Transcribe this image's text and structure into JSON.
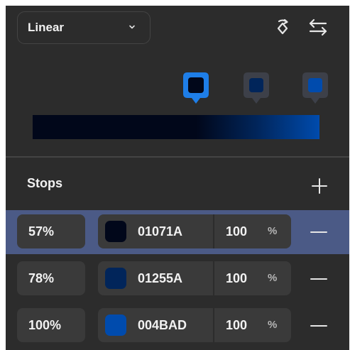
{
  "header": {
    "gradient_type": "Linear",
    "icons": {
      "dropdown": "chevron-down-icon",
      "rotate": "rotate-icon",
      "swap": "swap-arrows-icon"
    }
  },
  "gradient": {
    "colors": [
      "#01071A",
      "#01255A",
      "#004BAD"
    ],
    "positions_percent": [
      57,
      78,
      100
    ],
    "selected_index": 0,
    "selected_outline_color": "#1e7ee8",
    "unselected_marker_color": "#3d4049"
  },
  "stops_section": {
    "heading": "Stops",
    "add_icon": "plus-icon",
    "remove_icon": "minus-icon",
    "percent_symbol": "%",
    "rows": [
      {
        "position": "57%",
        "hex": "01071A",
        "color": "#01071A",
        "opacity": "100",
        "selected": true
      },
      {
        "position": "78%",
        "hex": "01255A",
        "color": "#01255A",
        "opacity": "100",
        "selected": false
      },
      {
        "position": "100%",
        "hex": "004BAD",
        "color": "#004BAD",
        "opacity": "100",
        "selected": false
      }
    ]
  },
  "theme": {
    "panel_bg": "#2c2c2c",
    "field_bg": "#3a3a3a",
    "selected_row_bg": "#4b5a86",
    "text_color": "#f2f2f2"
  }
}
